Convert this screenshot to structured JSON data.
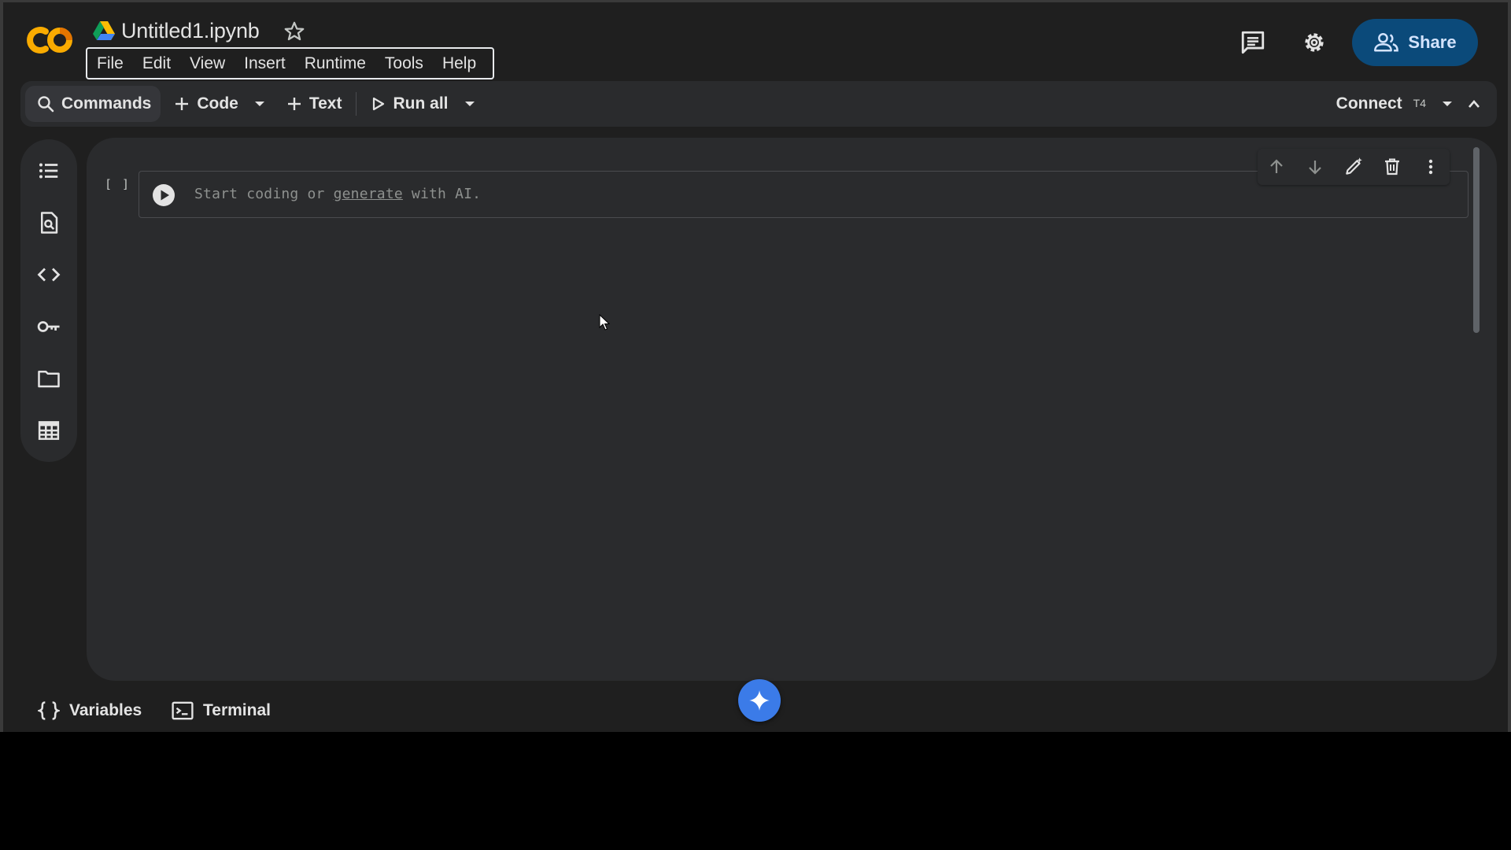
{
  "header": {
    "filename": "Untitled1.ipynb",
    "menu": [
      "File",
      "Edit",
      "View",
      "Insert",
      "Runtime",
      "Tools",
      "Help"
    ],
    "share_label": "Share"
  },
  "toolbar": {
    "commands_label": "Commands",
    "code_label": "Code",
    "text_label": "Text",
    "run_all_label": "Run all",
    "connect_label": "Connect",
    "runtime_type": "T4"
  },
  "cell": {
    "bracket": "[ ]",
    "placeholder_prefix": "Start coding or ",
    "placeholder_link": "generate",
    "placeholder_suffix": " with AI."
  },
  "bottom": {
    "variables_label": "Variables",
    "terminal_label": "Terminal"
  },
  "colors": {
    "background": "#1f1f1f",
    "surface": "#2a2b2d",
    "share_button": "#0b4a7a",
    "gemini_fab": "#3b7be8",
    "logo_orange": "#f9ab00"
  }
}
